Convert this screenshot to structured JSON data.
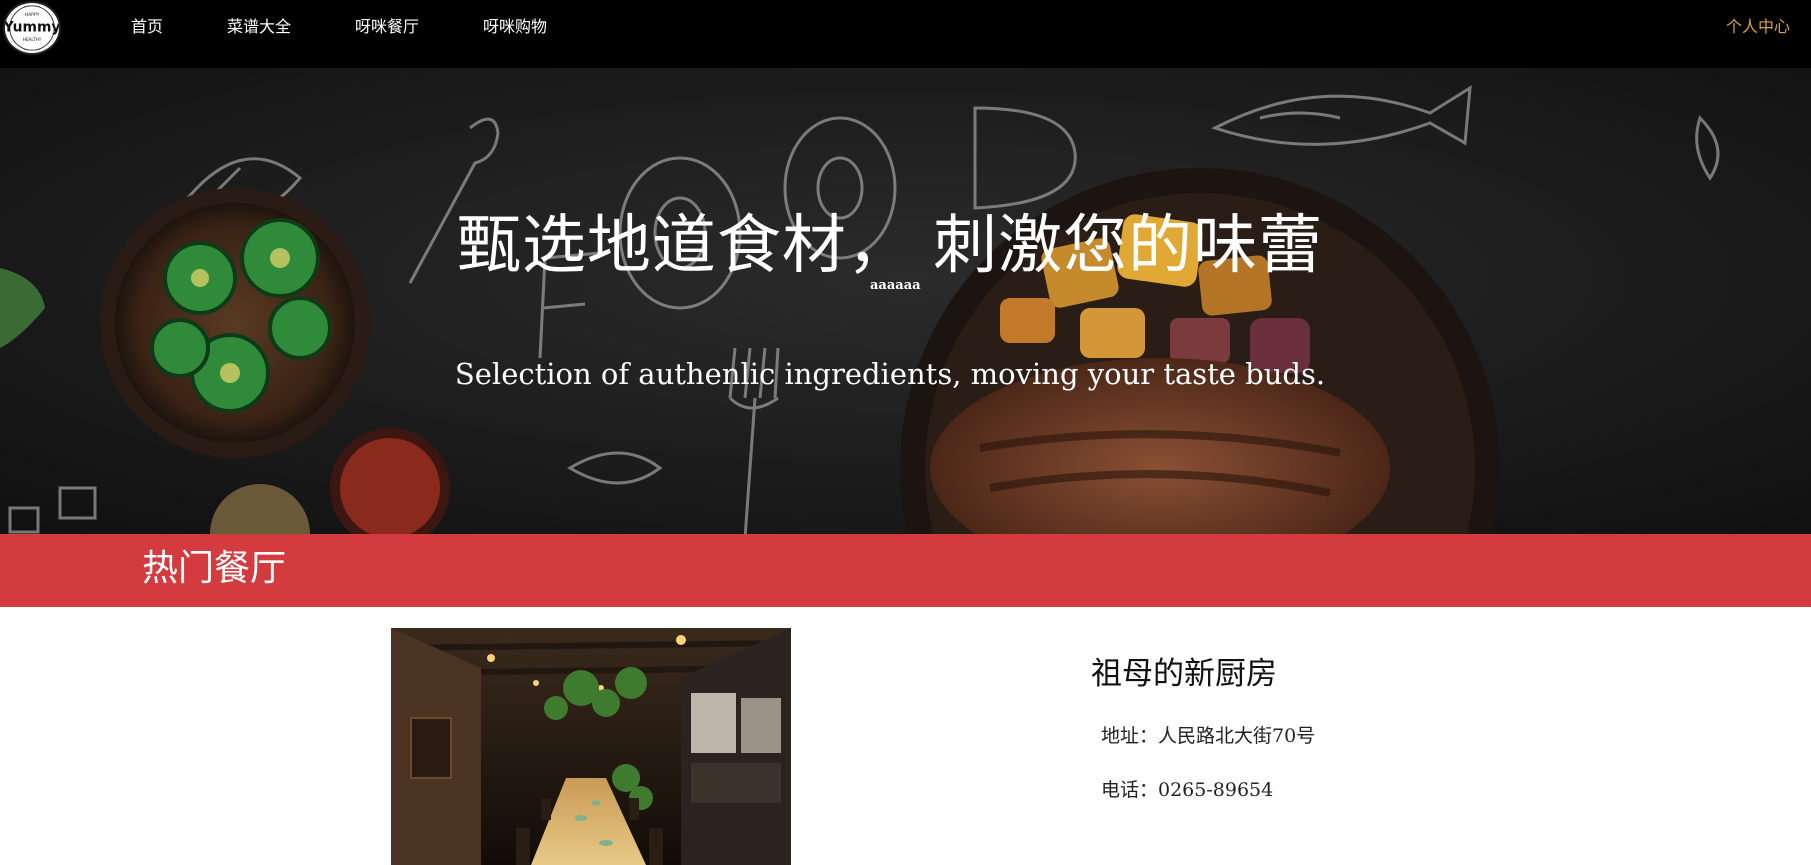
{
  "logo": {
    "top_text": "HAPPY",
    "main_text": "Yummy",
    "bottom_text": "HEALTHY"
  },
  "nav": {
    "items": [
      {
        "label": "首页"
      },
      {
        "label": "菜谱大全"
      },
      {
        "label": "呀咪餐厅"
      },
      {
        "label": "呀咪购物"
      }
    ],
    "user_center": "个人中心",
    "user_center_color": "#d9a33a"
  },
  "hero": {
    "title": "甄选地道食材， 刺激您的味蕾",
    "small_text": "aaaaaa",
    "subtitle": "Selection of authenlic ingredients, moving your taste buds."
  },
  "section": {
    "title": "热门餐厅",
    "band_color": "#d33b3f"
  },
  "restaurant": {
    "name": "祖母的新厨房",
    "address": "地址：人民路北大街70号",
    "phone": "电话：0265-89654"
  }
}
